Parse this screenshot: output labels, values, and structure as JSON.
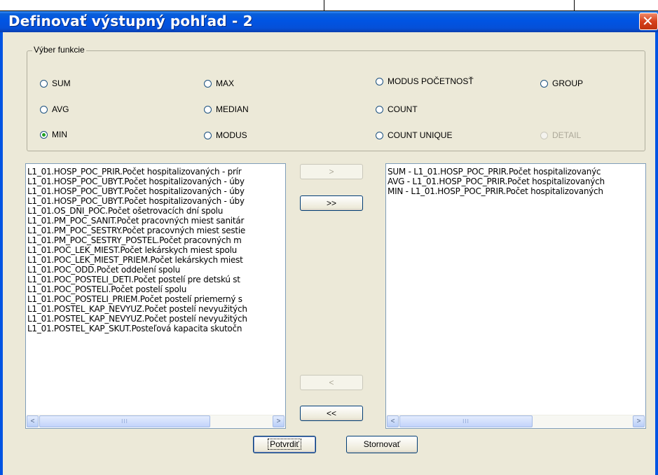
{
  "window": {
    "title": "Definovať výstupný pohľad - 2",
    "close_glyph": "✕"
  },
  "functions": {
    "legend": "Výber funkcie",
    "options": [
      {
        "label": "SUM",
        "checked": false,
        "enabled": true
      },
      {
        "label": "MAX",
        "checked": false,
        "enabled": true
      },
      {
        "label": "MODUS POČETNOSŤ",
        "checked": false,
        "enabled": true
      },
      {
        "label": "GROUP",
        "checked": false,
        "enabled": true
      },
      {
        "label": "AVG",
        "checked": false,
        "enabled": true
      },
      {
        "label": "MEDIAN",
        "checked": false,
        "enabled": true
      },
      {
        "label": "COUNT",
        "checked": false,
        "enabled": true
      },
      {
        "label": "MIN",
        "checked": true,
        "enabled": true
      },
      {
        "label": "MODUS",
        "checked": false,
        "enabled": true
      },
      {
        "label": "COUNT UNIQUE",
        "checked": false,
        "enabled": true
      },
      {
        "label": "DETAIL",
        "checked": false,
        "enabled": false
      }
    ]
  },
  "available_list": {
    "items": [
      "L1_01.HOSP_POC_PRIR.Počet hospitalizovaných - prír",
      "L1_01.HOSP_POC_UBYT.Počet hospitalizovaných - úby",
      "L1_01.HOSP_POC_UBYT.Počet hospitalizovaných - úby",
      "L1_01.HOSP_POC_UBYT.Počet hospitalizovaných - úby",
      "L1_01.OS_DNI_POC.Počet ošetrovacích dní spolu",
      "L1_01.PM_POC_SANIT.Počet pracovných miest sanitár",
      "L1_01.PM_POC_SESTRY.Počet pracovných miest sestie",
      "L1_01.PM_POC_SESTRY_POSTEL.Počet pracovných m",
      "L1_01.POC_LEK_MIEST.Počet lekárskych miest spolu",
      "L1_01.POC_LEK_MIEST_PRIEM.Počet lekárskych miest",
      "L1_01.POC_ODD.Počet oddelení spolu",
      "L1_01.POC_POSTELI_DETI.Počet postelí pre detskú st",
      "L1_01.POC_POSTELI.Počet postelí spolu",
      "L1_01.POC_POSTELI_PRIEM.Počet postelí priemerný s",
      "L1_01.POSTEL_KAP_NEVYUZ.Počet postelí nevyužitých",
      "L1_01.POSTEL_KAP_NEVYUZ.Počet postelí nevyužitých",
      "L1_01.POSTEL_KAP_SKUT.Posteľová kapacita skutočn"
    ]
  },
  "selected_list": {
    "items": [
      "SUM - L1_01.HOSP_POC_PRIR.Počet hospitalizovanýc",
      "AVG - L1_01.HOSP_POC_PRIR.Počet hospitalizovaných",
      "MIN - L1_01.HOSP_POC_PRIR.Počet hospitalizovaných"
    ]
  },
  "transfer": {
    "add": ">",
    "add_all": ">>",
    "remove": "<",
    "remove_all": "<<"
  },
  "scroll": {
    "left_arrow": "<",
    "right_arrow": ">",
    "grip": "III"
  },
  "footer": {
    "confirm": "Potvrdiť",
    "cancel": "Stornovať"
  }
}
